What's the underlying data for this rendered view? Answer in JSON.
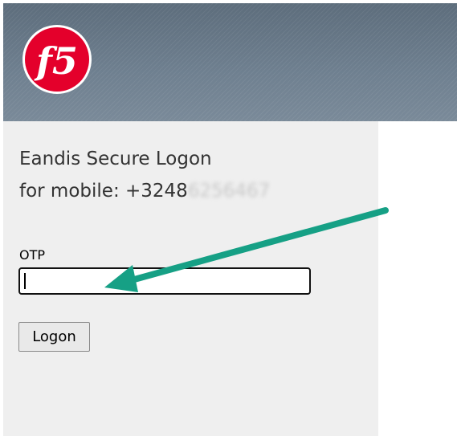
{
  "header": {
    "logo_text": "f5"
  },
  "logon": {
    "title_line_1": "Eandis Secure Logon",
    "title_line_2_prefix": "for mobile: +3248",
    "title_line_2_blurred": "6256467"
  },
  "form": {
    "otp_label": "OTP",
    "otp_value": "",
    "logon_button_label": "Logon"
  },
  "colors": {
    "annotation_arrow": "#16a085",
    "logo_red": "#e4002b"
  }
}
